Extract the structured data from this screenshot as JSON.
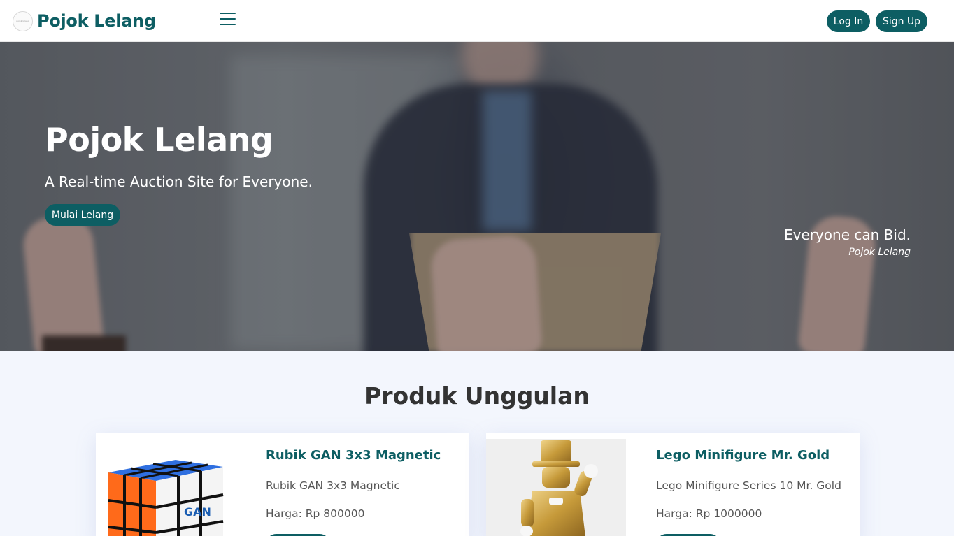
{
  "navbar": {
    "brand": "Pojok Lelang",
    "logo_text": "pojok lelang",
    "login_label": "Log In",
    "signup_label": "Sign Up"
  },
  "hero": {
    "title": "Pojok Lelang",
    "subtitle": "A Real-time Auction Site for Everyone.",
    "cta_label": "Mulai Lelang",
    "quote": "Everyone can Bid.",
    "quote_cite": "Pojok Lelang"
  },
  "featured": {
    "heading": "Produk Unggulan",
    "products": [
      {
        "title": "Rubik GAN 3x3 Magnetic",
        "description": "Rubik GAN 3x3 Magnetic",
        "price": "Harga: Rp 800000"
      },
      {
        "title": "Lego Minifigure Mr. Gold",
        "description": "Lego Minifigure Series 10 Mr. Gold",
        "price": "Harga: Rp 1000000"
      }
    ]
  },
  "colors": {
    "primary": "#0d5e63",
    "page_background": "#f3f6fd"
  },
  "icons": [
    "menu-hamburger-icon"
  ]
}
